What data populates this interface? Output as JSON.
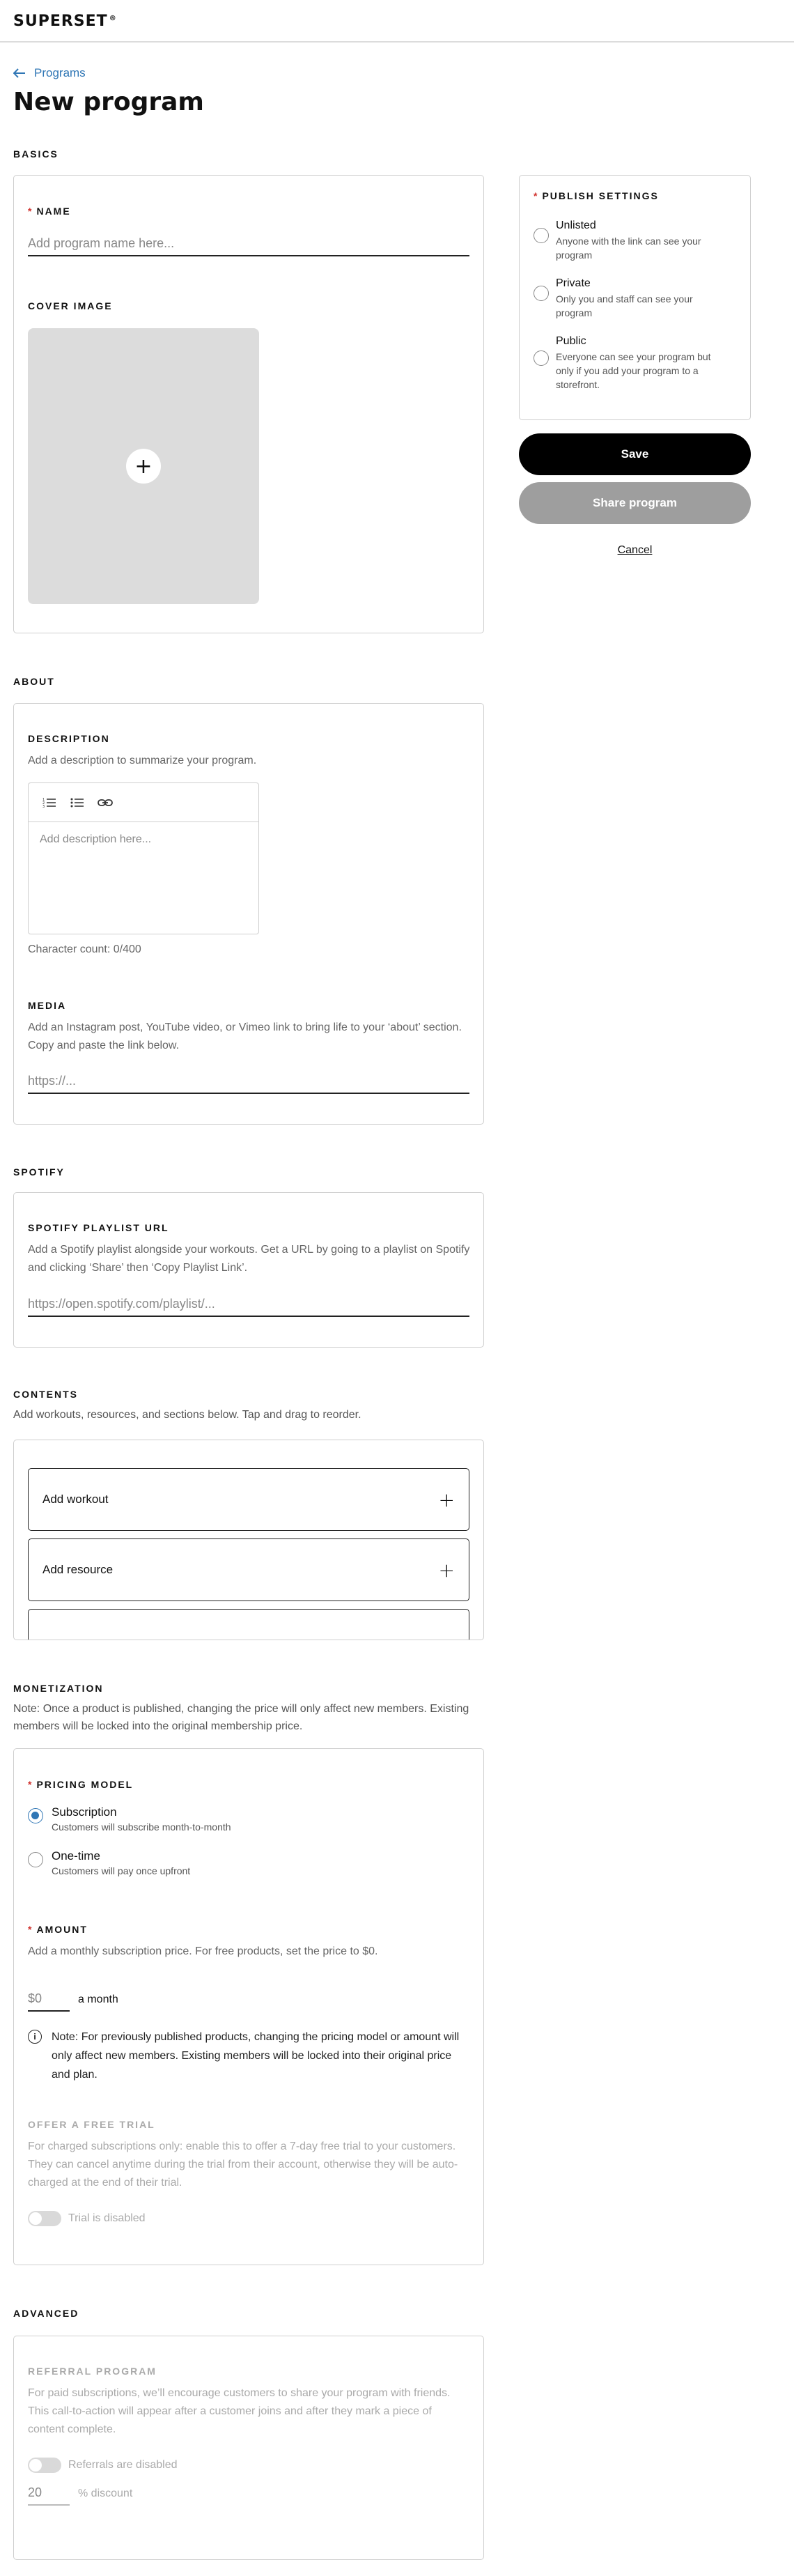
{
  "app": {
    "logo": "SUPERSET",
    "logo_mark": "®"
  },
  "nav": {
    "back_label": "Programs"
  },
  "page": {
    "title": "New program"
  },
  "basics": {
    "section_title": "BASICS",
    "name_label": "NAME",
    "name_placeholder": "Add program name here...",
    "cover_label": "COVER IMAGE"
  },
  "about": {
    "section_title": "ABOUT",
    "description_label": "DESCRIPTION",
    "description_help": "Add a description to summarize your program.",
    "description_placeholder": "Add description here...",
    "char_count": "Character count: 0/400",
    "media_label": "MEDIA",
    "media_help": "Add an Instagram post, YouTube video, or Vimeo link to bring life to your ‘about’ section. Copy and paste the link below.",
    "media_placeholder": "https://..."
  },
  "spotify": {
    "section_title": "SPOTIFY",
    "label": "SPOTIFY PLAYLIST URL",
    "help": "Add a Spotify playlist alongside your workouts. Get a URL by going to a playlist on Spotify and clicking ‘Share’ then ‘Copy Playlist Link’.",
    "placeholder": "https://open.spotify.com/playlist/..."
  },
  "contents": {
    "section_title": "CONTENTS",
    "note": "Add workouts, resources, and sections below. Tap and drag to reorder.",
    "add_workout": "Add workout",
    "add_resource": "Add resource",
    "plus": "+"
  },
  "monetization": {
    "section_title": "MONETIZATION",
    "note": "Note: Once a product is published, changing the price will only affect new members. Existing members will be locked into the original membership price.",
    "pricing_label": "PRICING MODEL",
    "options": [
      {
        "title": "Subscription",
        "sub": "Customers will subscribe month-to-month",
        "selected": true
      },
      {
        "title": "One-time",
        "sub": "Customers will pay once upfront",
        "selected": false
      }
    ],
    "amount_label": "AMOUNT",
    "amount_help": "Add a monthly subscription price. For free products, set the price to $0.",
    "amount_placeholder": "$0",
    "amount_unit": "a month",
    "info_icon": "i",
    "info_note": "Note: For previously published products, changing the pricing model or amount will only affect new members. Existing members will be locked into their original price and plan.",
    "trial_label": "OFFER A FREE TRIAL",
    "trial_help": "For charged subscriptions only: enable this to offer a 7-day free trial to your customers. They can cancel anytime during the trial from their account, otherwise they will be auto-charged at the end of their trial.",
    "trial_toggle": "Trial is disabled"
  },
  "advanced": {
    "section_title": "ADVANCED",
    "referral_label": "REFERRAL PROGRAM",
    "referral_help": "For paid subscriptions, we’ll encourage customers to share your program with friends. This call-to-action will appear after a customer joins and after they mark a piece of content complete.",
    "referral_toggle": "Referrals are disabled",
    "discount_placeholder": "20",
    "discount_unit": "% discount"
  },
  "publish": {
    "title": "PUBLISH SETTINGS",
    "options": [
      {
        "title": "Unlisted",
        "sub": "Anyone with the link can see your program"
      },
      {
        "title": "Private",
        "sub": "Only you and staff can see your program"
      },
      {
        "title": "Public",
        "sub": "Everyone can see your program but only if you add your program to a storefront."
      }
    ],
    "save": "Save",
    "share": "Share program",
    "cancel": "Cancel"
  }
}
